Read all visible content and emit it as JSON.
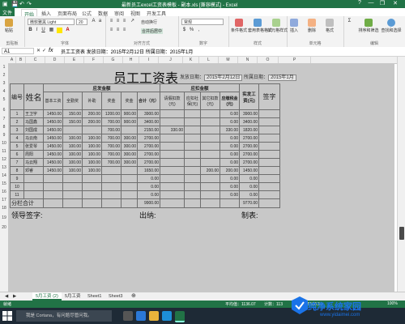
{
  "window": {
    "title": "最新员工excel工资表模板 - 副本.xls [兼容模式] - Excel",
    "minimize": "—",
    "restore": "❐",
    "close": "✕",
    "help": "?"
  },
  "tabs": [
    "文件",
    "开始",
    "插入",
    "页面布局",
    "公式",
    "数据",
    "审阅",
    "视图",
    "开发工具"
  ],
  "ribbon": {
    "clipboard": {
      "paste": "粘贴",
      "label": "剪贴板"
    },
    "font": {
      "name": "微软雅黑 Light",
      "size": "20",
      "bold": "B",
      "italic": "I",
      "underline": "U",
      "label": "字体"
    },
    "align": {
      "wrap": "自动换行",
      "merge": "合并后居中",
      "label": "对齐方式"
    },
    "number": {
      "format": "常规",
      "label": "数字"
    },
    "styles": {
      "conditional": "条件格式",
      "table": "套用表格格式",
      "cell": "单元格样式",
      "label": "样式"
    },
    "cells": {
      "insert": "插入",
      "delete": "删除",
      "format": "格式",
      "label": "单元格"
    },
    "editing": {
      "sort": "排序和筛选",
      "find": "查找和选择",
      "label": "编辑"
    }
  },
  "formula_bar": {
    "name_box": "A1",
    "fx": "fx",
    "content": "员工工资表    发放日期：2015年2月12日  所属日期：2015年1月"
  },
  "columns": [
    "A",
    "B",
    "C",
    "D",
    "E",
    "F",
    "G",
    "H",
    "I",
    "J",
    "K",
    "L",
    "M",
    "N",
    "O",
    "P"
  ],
  "rows": [
    "1",
    "2",
    "3",
    "4",
    "5",
    "6",
    "7",
    "8",
    "9",
    "10",
    "11",
    "12",
    "13",
    "14",
    "15",
    "16",
    "17",
    "18",
    "19",
    "20"
  ],
  "payroll": {
    "title": "员工工资表",
    "issue_date_label": "发放日期：",
    "issue_date": "2015年2月12日",
    "period_label": "所属日期：",
    "period": "2015年1月",
    "headers": {
      "no": "编号",
      "name": "姓名",
      "payable": "应发金额",
      "base": "基本工资",
      "full_attendance": "全勤奖",
      "subsidy": "补助",
      "bonus": "奖金",
      "award": "奖金",
      "subtotal": "合计（元）",
      "deduct": "应扣金额",
      "leave": "请假扣款(元)",
      "social": "应扣社保(元)",
      "other": "其它扣款(元)",
      "tax": "应缴税金(元)",
      "net": "实发工资(元)",
      "signature": "签字"
    },
    "rows": [
      {
        "no": "1",
        "name": "王卫宇",
        "base": "1450.00",
        "full": "150.00",
        "sub": "200.00",
        "bonus": "1200.00",
        "award": "900.00",
        "total": "3900.00",
        "leave": "",
        "social": "",
        "other": "",
        "tax": "0.00",
        "net": "3900.00"
      },
      {
        "no": "2",
        "name": "马国鑫",
        "base": "1450.00",
        "full": "150.00",
        "sub": "200.00",
        "bonus": "700.00",
        "award": "900.00",
        "total": "3400.00",
        "leave": "",
        "social": "",
        "other": "",
        "tax": "0.00",
        "net": "3400.00"
      },
      {
        "no": "3",
        "name": "刘国成",
        "base": "1450.00",
        "full": "",
        "sub": "",
        "bonus": "700.00",
        "award": "",
        "total": "2150.00",
        "leave": "330.00",
        "social": "",
        "other": "",
        "tax": "330.00",
        "net": "1820.00"
      },
      {
        "no": "4",
        "name": "马云南",
        "base": "1450.00",
        "full": "100.00",
        "sub": "100.00",
        "bonus": "700.00",
        "award": "300.00",
        "total": "2700.00",
        "leave": "",
        "social": "",
        "other": "",
        "tax": "0.00",
        "net": "2700.00"
      },
      {
        "no": "5",
        "name": "张爱琴",
        "base": "1450.00",
        "full": "100.00",
        "sub": "100.00",
        "bonus": "700.00",
        "award": "300.00",
        "total": "2700.00",
        "leave": "",
        "social": "",
        "other": "",
        "tax": "0.00",
        "net": "2700.00"
      },
      {
        "no": "6",
        "name": "周阳",
        "base": "1450.00",
        "full": "100.00",
        "sub": "100.00",
        "bonus": "700.00",
        "award": "300.00",
        "total": "2700.00",
        "leave": "",
        "social": "",
        "other": "",
        "tax": "0.00",
        "net": "2700.00"
      },
      {
        "no": "7",
        "name": "马云翔",
        "base": "1450.00",
        "full": "100.00",
        "sub": "100.00",
        "bonus": "700.00",
        "award": "300.00",
        "total": "2700.00",
        "leave": "",
        "social": "",
        "other": "",
        "tax": "0.00",
        "net": "2700.00"
      },
      {
        "no": "8",
        "name": "邓睿",
        "base": "1450.00",
        "full": "100.00",
        "sub": "100.00",
        "bonus": "",
        "award": "",
        "total": "1650.00",
        "leave": "",
        "social": "",
        "other": "200.00",
        "tax": "200.00",
        "net": "1450.00"
      },
      {
        "no": "9",
        "name": "",
        "base": "",
        "full": "",
        "sub": "",
        "bonus": "",
        "award": "",
        "total": "0.00",
        "leave": "",
        "social": "",
        "other": "",
        "tax": "0.00",
        "net": "0.00"
      },
      {
        "no": "10",
        "name": "",
        "base": "",
        "full": "",
        "sub": "",
        "bonus": "",
        "award": "",
        "total": "0.00",
        "leave": "",
        "social": "",
        "other": "",
        "tax": "0.00",
        "net": "0.00"
      },
      {
        "no": "11",
        "name": "",
        "base": "",
        "full": "",
        "sub": "",
        "bonus": "",
        "award": "",
        "total": "0.00",
        "leave": "",
        "social": "",
        "other": "",
        "tax": "0.00",
        "net": "0.00"
      }
    ],
    "total_label": "分栏合计",
    "grand_total": "9900.00",
    "grand_net": "9770.00",
    "sign_leader": "领导签字:",
    "sign_cashier": "出纳:",
    "sign_maker": "制表:"
  },
  "sheet_tabs": [
    "5月工资 (2)",
    "5月工资",
    "Sheet1",
    "Sheet3"
  ],
  "add_sheet": "⊕",
  "status": {
    "left": "就绪",
    "avg": "平均值：1136.07",
    "count": "计数：113",
    "sum": "求和：49100.50",
    "zoom": "100%"
  },
  "taskbar": {
    "search_placeholder": "我是 Cortana，有问题尽管问我。"
  },
  "watermark": {
    "brand": "纯净系统家园",
    "url": "www.yidaimei.com"
  },
  "colors": {
    "excel_green": "#217346",
    "sheet_grey": "#c8c8c8",
    "taskbar": "#1e2a36"
  }
}
